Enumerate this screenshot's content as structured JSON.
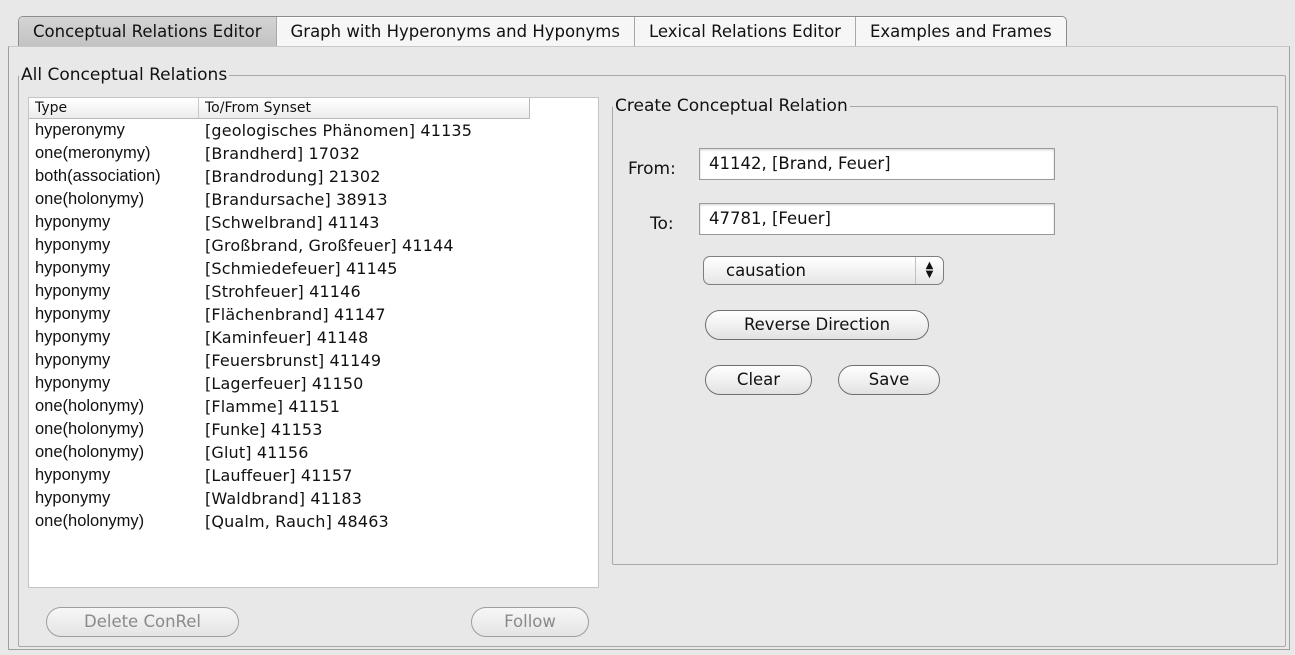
{
  "tabs": [
    {
      "label": "Conceptual Relations Editor"
    },
    {
      "label": "Graph with Hyperonyms and Hyponyms"
    },
    {
      "label": "Lexical Relations Editor"
    },
    {
      "label": "Examples and Frames"
    }
  ],
  "all_relations": {
    "title": "All Conceptual Relations",
    "columns": [
      "Type",
      "To/From Synset"
    ],
    "rows": [
      {
        "type": "hyperonymy",
        "synset": "[geologisches Phänomen] 41135"
      },
      {
        "type": "one(meronymy)",
        "synset": "[Brandherd] 17032"
      },
      {
        "type": "both(association)",
        "synset": "[Brandrodung] 21302"
      },
      {
        "type": "one(holonymy)",
        "synset": "[Brandursache] 38913"
      },
      {
        "type": "hyponymy",
        "synset": "[Schwelbrand] 41143"
      },
      {
        "type": "hyponymy",
        "synset": "[Großbrand, Großfeuer] 41144"
      },
      {
        "type": "hyponymy",
        "synset": "[Schmiedefeuer] 41145"
      },
      {
        "type": "hyponymy",
        "synset": "[Strohfeuer] 41146"
      },
      {
        "type": "hyponymy",
        "synset": "[Flächenbrand] 41147"
      },
      {
        "type": "hyponymy",
        "synset": "[Kaminfeuer] 41148"
      },
      {
        "type": "hyponymy",
        "synset": "[Feuersbrunst] 41149"
      },
      {
        "type": "hyponymy",
        "synset": "[Lagerfeuer] 41150"
      },
      {
        "type": "one(holonymy)",
        "synset": "[Flamme] 41151"
      },
      {
        "type": "one(holonymy)",
        "synset": "[Funke] 41153"
      },
      {
        "type": "one(holonymy)",
        "synset": "[Glut] 41156"
      },
      {
        "type": "hyponymy",
        "synset": "[Lauffeuer] 41157"
      },
      {
        "type": "hyponymy",
        "synset": "[Waldbrand] 41183"
      },
      {
        "type": "one(holonymy)",
        "synset": "[Qualm, Rauch] 48463"
      }
    ],
    "delete_label": "Delete ConRel",
    "follow_label": "Follow"
  },
  "create": {
    "title": "Create Conceptual Relation",
    "from_label": "From:",
    "from_value": "41142, [Brand, Feuer]",
    "to_label": "To:",
    "to_value": "47781, [Feuer]",
    "relation_selected": "causation",
    "reverse_label": "Reverse Direction",
    "clear_label": "Clear",
    "save_label": "Save"
  }
}
